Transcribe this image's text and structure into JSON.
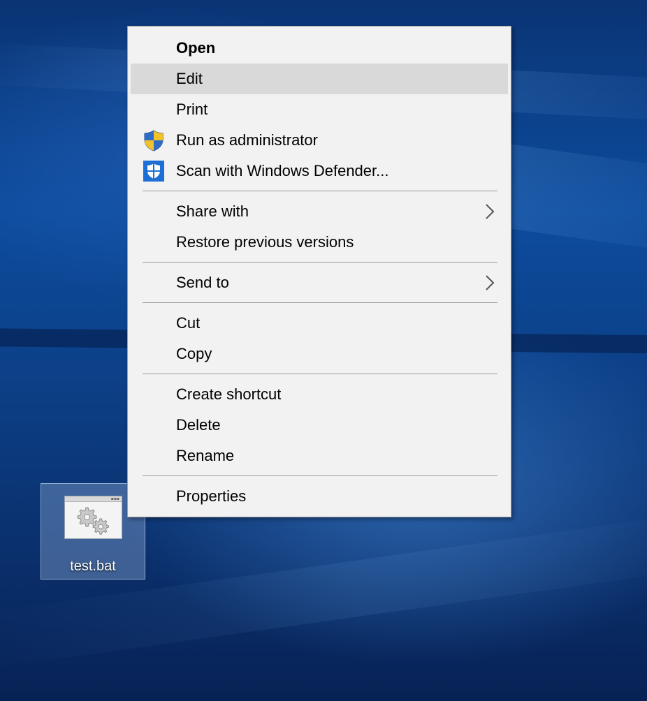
{
  "desktop": {
    "icon": {
      "label": "test.bat",
      "icon_name": "batch-file-gears-icon"
    }
  },
  "context_menu": {
    "highlight_color": "#d9d9d9",
    "items": [
      {
        "label": "Open",
        "bold": true
      },
      {
        "label": "Edit",
        "highlighted": true
      },
      {
        "label": "Print"
      },
      {
        "label": "Run as administrator",
        "icon": "uac-shield-icon"
      },
      {
        "label": "Scan with Windows Defender...",
        "icon": "windows-defender-icon"
      },
      {
        "label": "Share with",
        "submenu": true
      },
      {
        "label": "Restore previous versions"
      },
      {
        "label": "Send to",
        "submenu": true
      },
      {
        "label": "Cut"
      },
      {
        "label": "Copy"
      },
      {
        "label": "Create shortcut"
      },
      {
        "label": "Delete"
      },
      {
        "label": "Rename"
      },
      {
        "label": "Properties"
      }
    ]
  }
}
